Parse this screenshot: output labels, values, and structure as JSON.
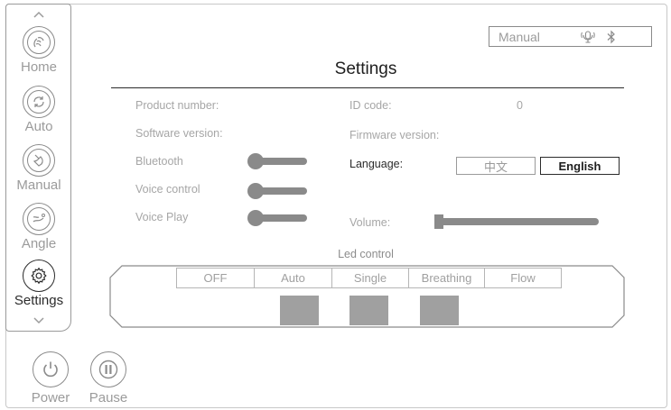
{
  "sidebar": {
    "items": [
      {
        "label": "Home",
        "icon": "hand-wave-icon"
      },
      {
        "label": "Auto",
        "icon": "auto-cycle-icon"
      },
      {
        "label": "Manual",
        "icon": "hand-tap-icon"
      },
      {
        "label": "Angle",
        "icon": "angle-icon"
      },
      {
        "label": "Settings",
        "icon": "gear-icon",
        "active": true
      }
    ]
  },
  "bottom": {
    "power_label": "Power",
    "pause_label": "Pause"
  },
  "header": {
    "mode": "Manual",
    "status_icons": [
      "voice-icon",
      "bluetooth-icon"
    ]
  },
  "page": {
    "title": "Settings"
  },
  "info": {
    "product_number_label": "Product number:",
    "software_version_label": "Software version:",
    "id_code_label": "ID code:",
    "id_code_value": "0",
    "firmware_version_label": "Firmware version:"
  },
  "toggles": {
    "bluetooth_label": "Bluetooth",
    "voice_control_label": "Voice control",
    "voice_play_label": "Voice Play"
  },
  "language": {
    "label": "Language:",
    "options": [
      "中文",
      "English"
    ],
    "selected": "English"
  },
  "volume": {
    "label": "Volume:",
    "level": 0
  },
  "led": {
    "title": "Led control",
    "modes": [
      "OFF",
      "Auto",
      "Single",
      "Breathing",
      "Flow"
    ],
    "swatch_colors": [
      "#a0a0a0",
      "#a0a0a0",
      "#a0a0a0"
    ]
  },
  "colors": {
    "active": "#2b2b2b",
    "inactive": "#9b9b9b"
  }
}
